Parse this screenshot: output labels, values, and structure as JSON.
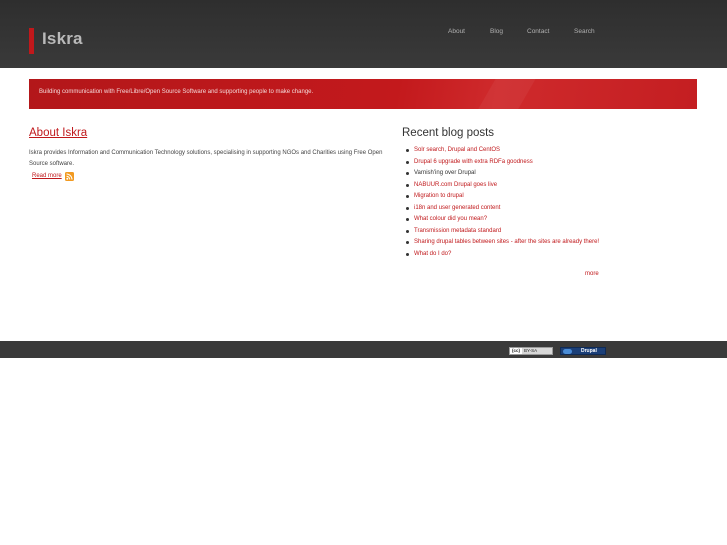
{
  "header": {
    "site_name": "Iskra",
    "nav": {
      "about": "About",
      "blog": "Blog",
      "contact": "Contact",
      "search": "Search"
    }
  },
  "banner": {
    "text": "Building communication with Free/Libre/Open Source Software and supporting people to make change."
  },
  "about": {
    "title": "About Iskra",
    "body": "Iskra provides Information and Communication Technology solutions, specialising in supporting NGOs and Charities using Free Open Source software.",
    "read_more": "Read more",
    "rss_icon": "rss-feed-icon"
  },
  "blog": {
    "title": "Recent blog posts",
    "posts": [
      "Solr search, Drupal and CentOS",
      "Drupal 6 upgrade with extra RDFa goodness",
      "Varnish'ing over Drupal",
      "NABUUR.com Drupal goes live",
      "Migration to drupal",
      "i18n and user generated content",
      "What colour did you mean?",
      "Transmission metadata standard",
      "Sharing drupal tables between sites - after the sites are already there!",
      "What do I do?"
    ],
    "more": "more"
  },
  "footer": {
    "cc_mark": "(cc)",
    "cc_text": "BY-SA",
    "drupal_text": "Drupal"
  },
  "colors": {
    "accent": "#c0181b",
    "header_bg": "#333333",
    "footer_bg": "#3a3a3a"
  }
}
